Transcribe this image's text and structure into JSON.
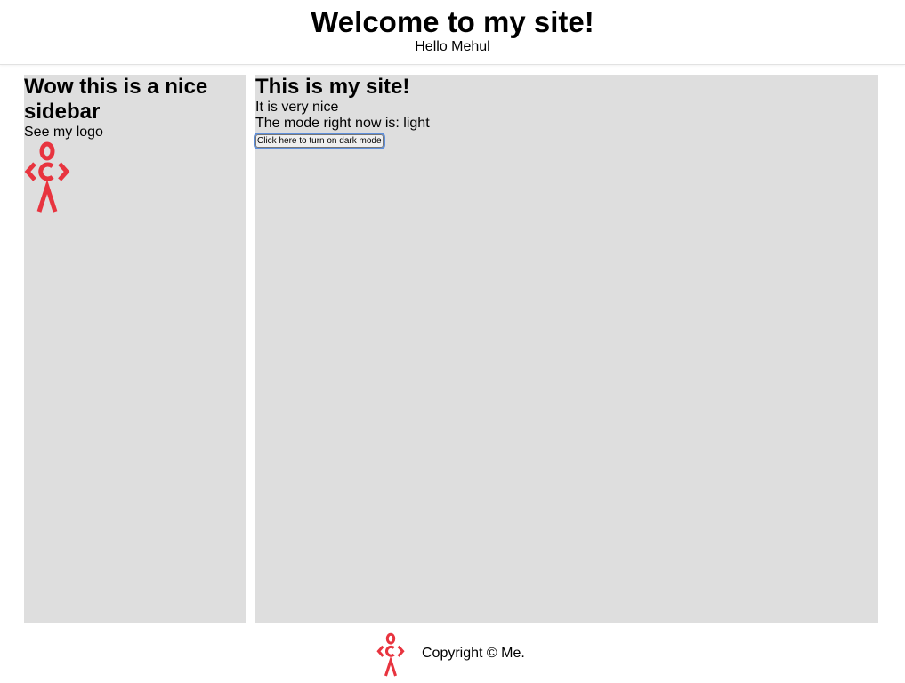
{
  "header": {
    "title": "Welcome to my site!",
    "greeting": "Hello Mehul"
  },
  "sidebar": {
    "title": "Wow this is a nice sidebar",
    "caption": "See my logo",
    "logo_icon": "stick-figure-logo-icon"
  },
  "main": {
    "title": "This is my site!",
    "line1": "It is very nice",
    "mode_text": "The mode right now is: light",
    "mode_button_label": "Click here to turn on dark mode"
  },
  "footer": {
    "logo_icon": "stick-figure-logo-icon",
    "copyright": "Copyright © Me."
  },
  "colors": {
    "panel_background": "#dedede",
    "logo_red": "#e8343f",
    "focus_ring": "#5e8fdc"
  }
}
